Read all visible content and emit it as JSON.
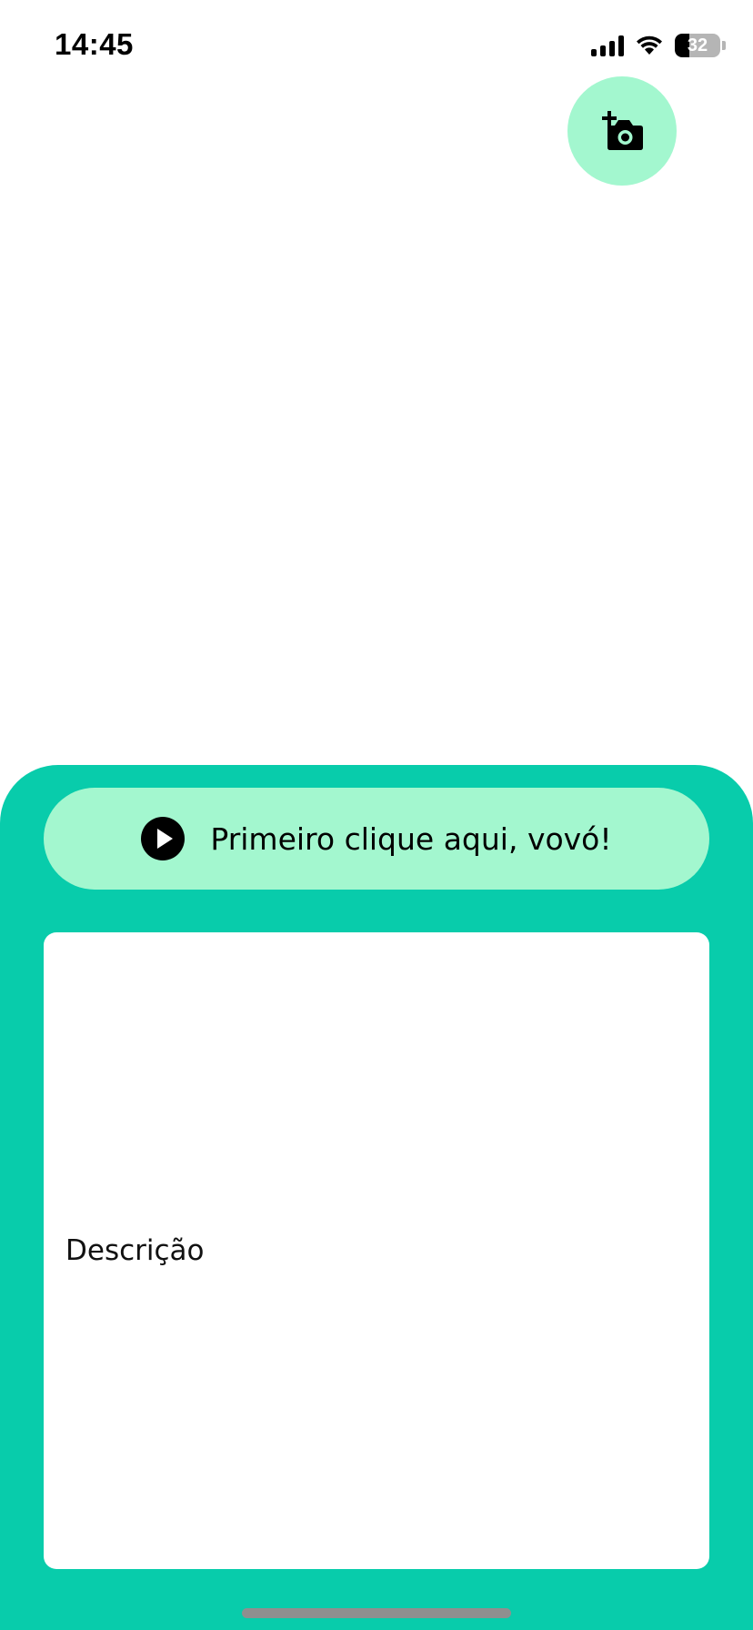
{
  "status_bar": {
    "time": "14:45",
    "battery_level": "32",
    "icons": [
      "signal-icon",
      "wifi-icon",
      "battery-icon"
    ]
  },
  "toolbar": {
    "add_photo_icon": "add-photo-camera-icon"
  },
  "player": {
    "label": "Primeiro clique aqui, vovó!",
    "icon": "play-icon"
  },
  "description": {
    "placeholder": "Descrição"
  },
  "colors": {
    "sheet_background": "#08ccab",
    "accent_light": "#a3f7cf",
    "text": "#000000"
  }
}
